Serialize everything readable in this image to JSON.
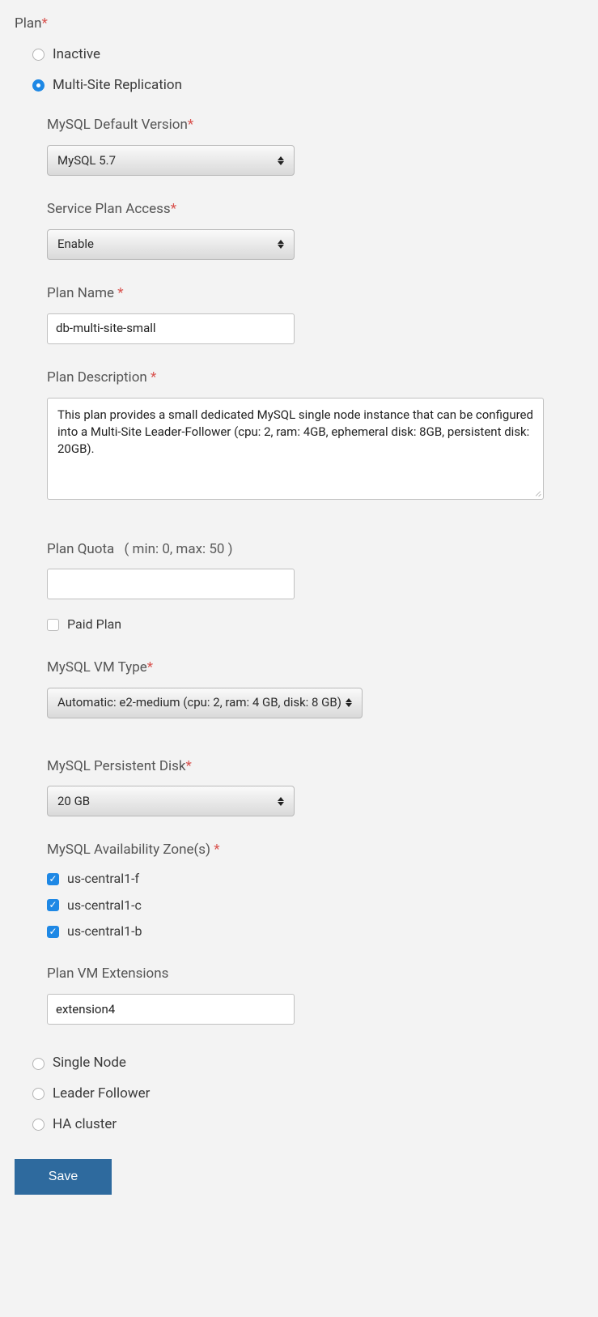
{
  "plan_section_label": "Plan",
  "required_marker": "*",
  "radios": {
    "inactive": "Inactive",
    "multi_site": "Multi-Site Replication",
    "single_node": "Single Node",
    "leader_follower": "Leader Follower",
    "ha_cluster": "HA cluster"
  },
  "mysql_version": {
    "label": "MySQL Default Version",
    "value": "MySQL 5.7"
  },
  "service_plan_access": {
    "label": "Service Plan Access",
    "value": "Enable"
  },
  "plan_name": {
    "label": "Plan Name ",
    "value": "db-multi-site-small"
  },
  "plan_description": {
    "label": "Plan Description ",
    "value": "This plan provides a small dedicated MySQL single node instance that can be configured into a Multi-Site Leader-Follower (cpu: 2, ram: 4GB, ephemeral disk: 8GB, persistent disk: 20GB)."
  },
  "plan_quota": {
    "label": "Plan Quota",
    "hint": "( min: 0, max: 50 )",
    "value": ""
  },
  "paid_plan": {
    "label": "Paid Plan",
    "checked": false
  },
  "mysql_vm_type": {
    "label": "MySQL VM Type",
    "value": "Automatic: e2-medium (cpu: 2, ram: 4 GB, disk: 8 GB)"
  },
  "mysql_persistent_disk": {
    "label": "MySQL Persistent Disk",
    "value": "20 GB"
  },
  "mysql_az": {
    "label": "MySQL Availability Zone(s) ",
    "zones": [
      {
        "name": "us-central1-f",
        "checked": true
      },
      {
        "name": "us-central1-c",
        "checked": true
      },
      {
        "name": "us-central1-b",
        "checked": true
      }
    ]
  },
  "vm_extensions": {
    "label": "Plan VM Extensions",
    "value": "extension4"
  },
  "save_label": "Save"
}
